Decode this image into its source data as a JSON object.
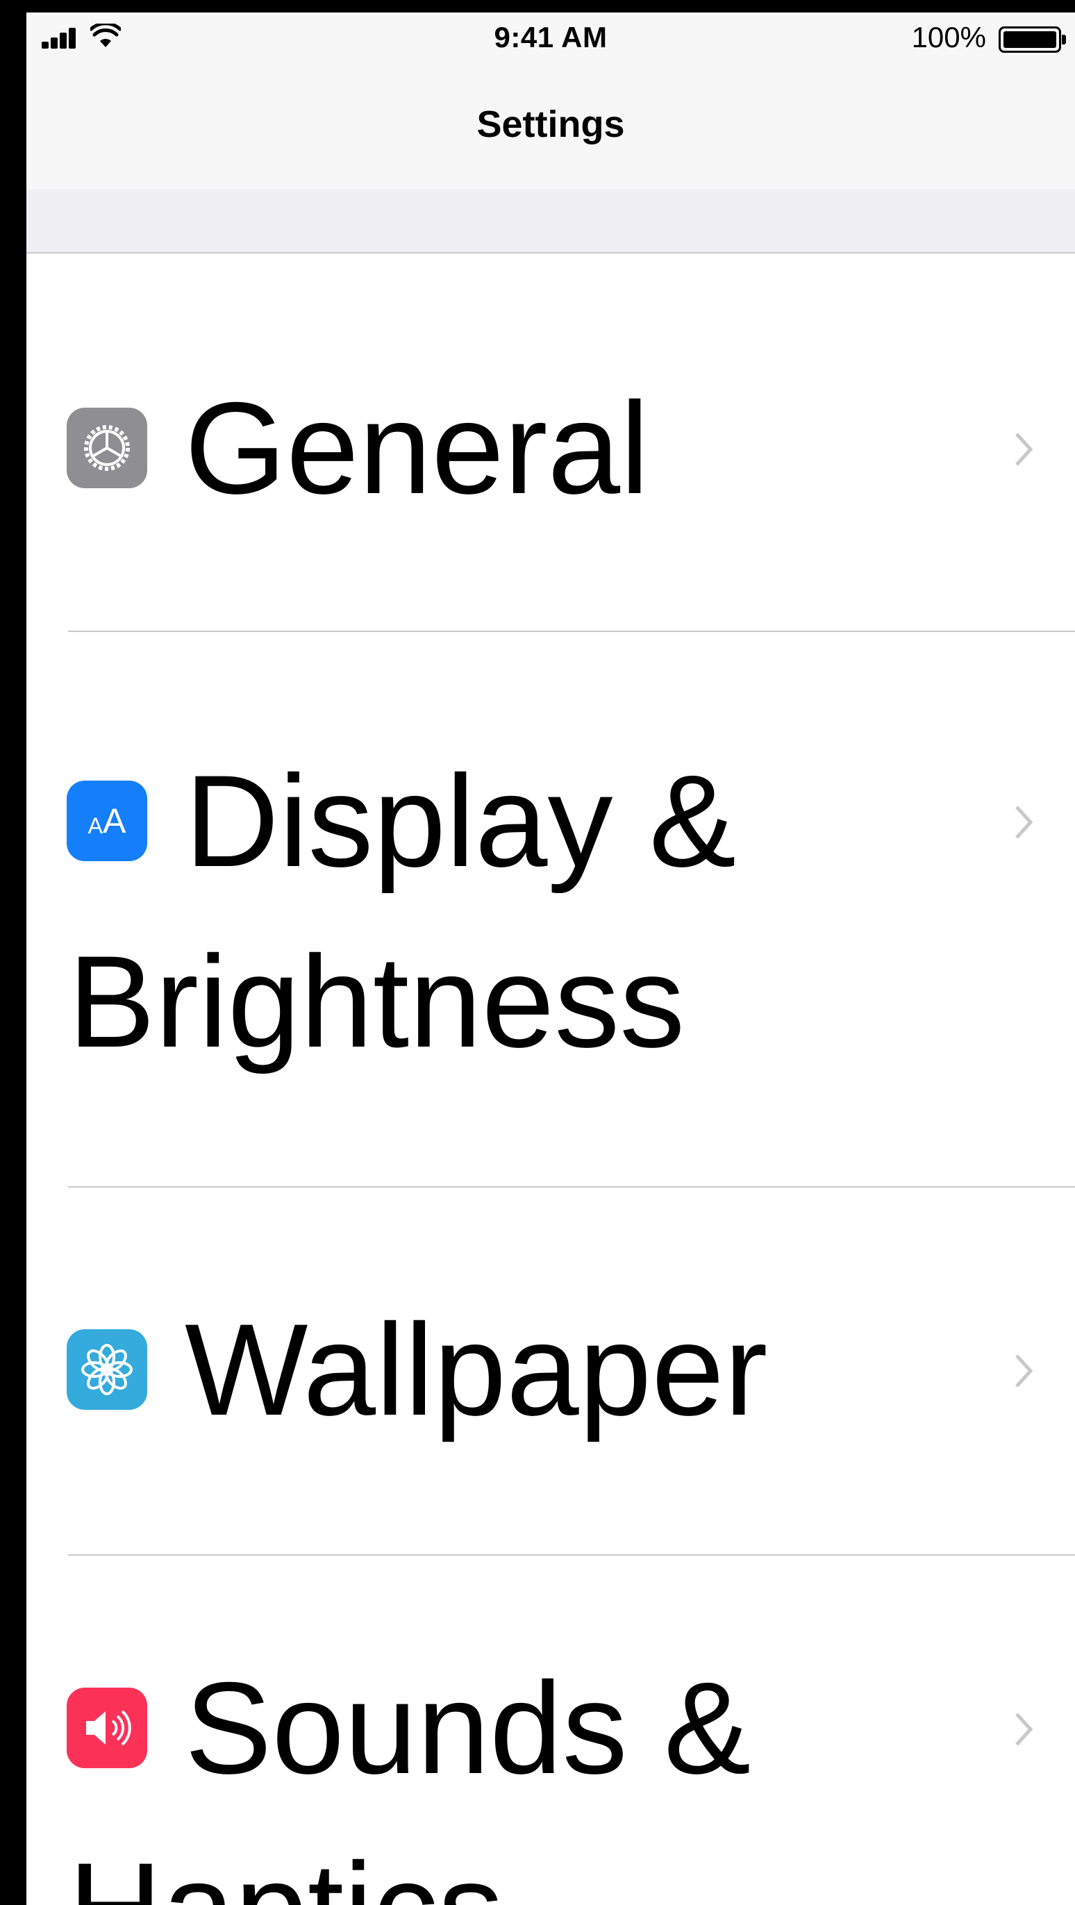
{
  "status_bar": {
    "time": "9:41 AM",
    "battery_percent": "100%",
    "battery_level": 1.0,
    "signal_icon": "cellular-signal-icon",
    "wifi_icon": "wifi-icon"
  },
  "nav": {
    "title": "Settings"
  },
  "settings": {
    "items": [
      {
        "label": "General",
        "icon": "gear-icon",
        "icon_color": "#8e8e93"
      },
      {
        "label": "Display & Brightness",
        "icon": "text-size-icon",
        "icon_color": "#157efb"
      },
      {
        "label": "Wallpaper",
        "icon": "flower-icon",
        "icon_color": "#35aadc"
      },
      {
        "label": "Sounds & Haptics",
        "icon": "speaker-icon",
        "icon_color": "#fc3158"
      }
    ]
  },
  "colors": {
    "separator": "#c8c7cc",
    "chevron": "#c7c7cc",
    "grouped_background": "#efeff4"
  }
}
